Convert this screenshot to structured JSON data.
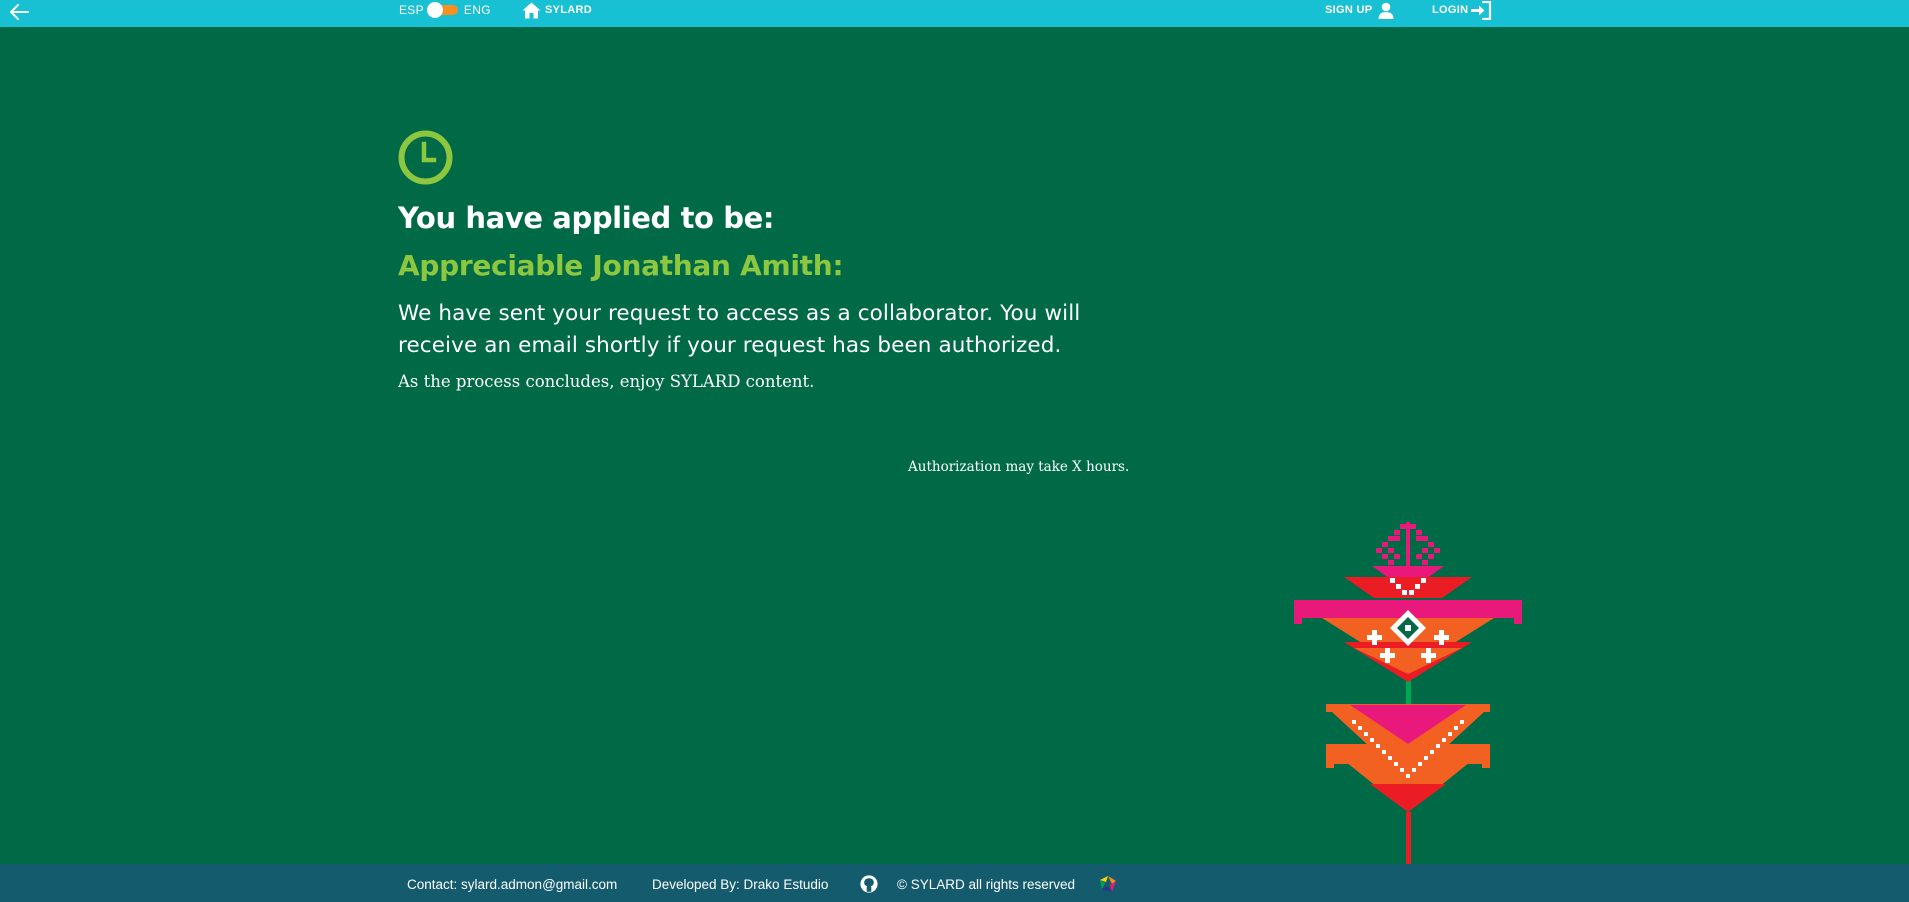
{
  "header": {
    "back_icon": "arrow-left-icon",
    "lang_left": "ESP",
    "lang_right": "ENG",
    "lang_selected": "ESP",
    "home_icon": "home-icon",
    "home_label": "SYLARD",
    "signup_label": "SIGN UP",
    "signup_icon": "user-icon",
    "login_label": "LOGIN",
    "login_icon": "sign-in-icon"
  },
  "main": {
    "status_icon": "clock-icon",
    "heading": "You have applied to be:",
    "greeting": "Appreciable Jonathan Amith:",
    "message": "We have sent your request to access as a collaborator. You will receive an email shortly if your request has been authorized.",
    "enjoy_note": "As the process concludes, enjoy SYLARD content.",
    "authorization_note": "Authorization may take X hours."
  },
  "footer": {
    "contact": "Contact: sylard.admon@gmail.com",
    "developer": "Developed By: Drako Estudio",
    "github_icon": "github-icon",
    "rights": "© SYLARD all rights reserved",
    "brand_icon": "drako-logo-icon"
  },
  "colors": {
    "background": "#006a47",
    "topbar": "#17c0d2",
    "footer": "#145b6e",
    "accent_green": "#8dc63f",
    "toggle_orange": "#f7901e",
    "ornament_pink": "#e8197a",
    "ornament_red": "#ec1c24",
    "ornament_orange": "#f26122",
    "ornament_stem": "#00a651"
  }
}
